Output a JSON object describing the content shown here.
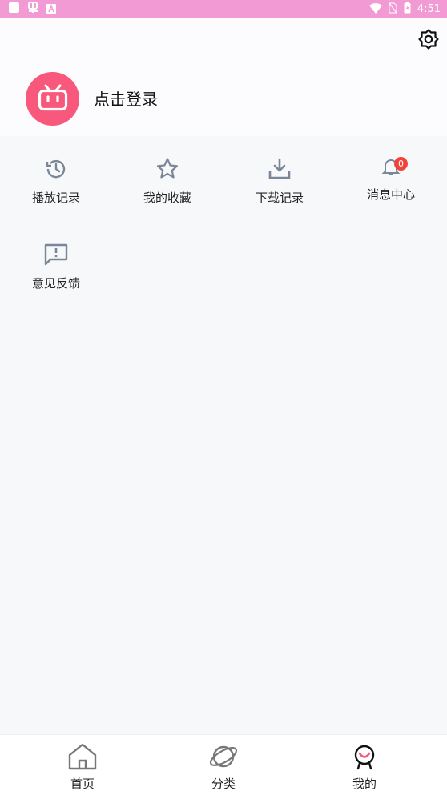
{
  "status_bar": {
    "time": "4:51",
    "icons": [
      "app-square-icon",
      "bug-icon",
      "a-notification-icon",
      "wifi-icon",
      "no-sim-icon",
      "battery-icon"
    ]
  },
  "header": {
    "login_text": "点击登录",
    "avatar_icon": "bilibili-tv-icon",
    "settings_icon": "gear-icon"
  },
  "menu": {
    "items": [
      {
        "label": "播放记录",
        "icon": "history-icon"
      },
      {
        "label": "我的收藏",
        "icon": "star-icon"
      },
      {
        "label": "下载记录",
        "icon": "download-icon"
      },
      {
        "label": "消息中心",
        "icon": "bell-icon",
        "badge": "0"
      },
      {
        "label": "意见反馈",
        "icon": "feedback-icon"
      }
    ]
  },
  "bottom_nav": {
    "items": [
      {
        "label": "首页",
        "icon": "home-icon"
      },
      {
        "label": "分类",
        "icon": "planet-icon"
      },
      {
        "label": "我的",
        "icon": "profile-icon",
        "active": true
      }
    ]
  },
  "colors": {
    "status_bar": "#f29ad4",
    "accent": "#f7587b",
    "badge": "#f0433a",
    "icon_gray": "#7a8797"
  }
}
